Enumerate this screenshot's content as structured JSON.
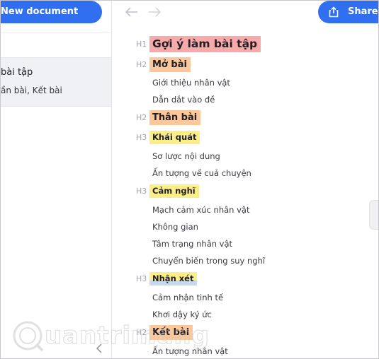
{
  "sidebar": {
    "new_document_label": "New document",
    "doc_title": "bài tập",
    "doc_sub": "ần bài, Kết bài"
  },
  "toolbar": {
    "share_label": "Share",
    "accent": "#2f6ff0"
  },
  "outline": [
    {
      "level": "H1",
      "text": "Gợi ý làm bài tập"
    },
    {
      "level": "H2",
      "text": "Mở bài"
    },
    {
      "level": "",
      "text": "Giới thiệu nhân vật"
    },
    {
      "level": "",
      "text": "Dẫn dắt vào đề"
    },
    {
      "level": "H2",
      "text": "Thân bài"
    },
    {
      "level": "H3",
      "text": "Khái quát"
    },
    {
      "level": "",
      "text": "Sơ lược nội dung"
    },
    {
      "level": "",
      "text": "Ấn tượng về cuả chuyện"
    },
    {
      "level": "H3",
      "text": "Cảm nghĩ"
    },
    {
      "level": "",
      "text": "Mạch cảm xúc nhân vật"
    },
    {
      "level": "",
      "text": "Không gian"
    },
    {
      "level": "",
      "text": "Tâm trạng nhân vật"
    },
    {
      "level": "",
      "text": "Chuyển biến trong suy nghĩ"
    },
    {
      "level": "H3",
      "text": "Nhận xét"
    },
    {
      "level": "",
      "text": "Cảm nhận tinh tế"
    },
    {
      "level": "",
      "text": "Khơi dậy ký ức"
    },
    {
      "level": "H2",
      "text": "Kết bài"
    },
    {
      "level": "",
      "text": "Ấn tượng nhân vật"
    }
  ],
  "highlight_colors": {
    "H1": "#f8a9a9",
    "H2": "#fcc79b",
    "H3": "#fbee86"
  },
  "watermark": {
    "text": "uantrimang"
  }
}
